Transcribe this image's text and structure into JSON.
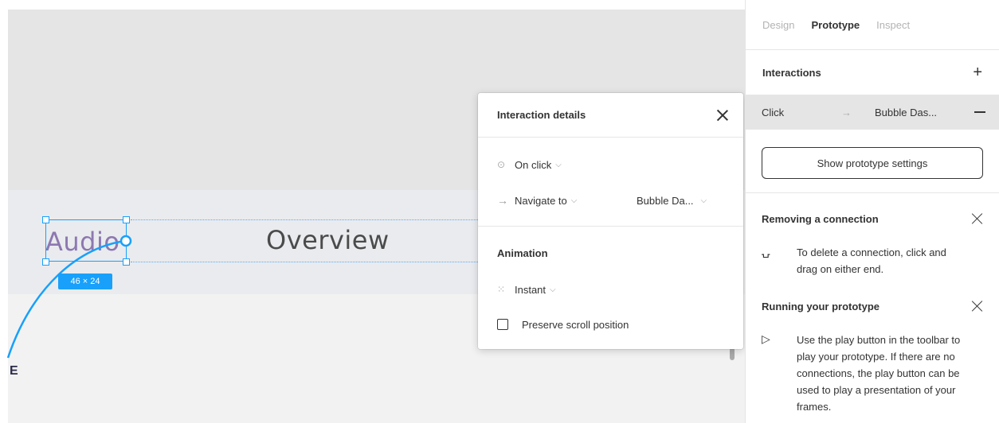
{
  "canvas": {
    "audio_label": "Audio",
    "overview_label": "Overview",
    "size_badge": "46 × 24",
    "frame_letter": "E"
  },
  "popup": {
    "title": "Interaction details",
    "trigger_label": "On click",
    "action_label": "Navigate to",
    "destination_label": "Bubble Da...",
    "animation_title": "Animation",
    "animation_value": "Instant",
    "preserve_label": "Preserve scroll position",
    "preserve_checked": false
  },
  "panel": {
    "tabs": [
      {
        "label": "Design",
        "active": false
      },
      {
        "label": "Prototype",
        "active": true
      },
      {
        "label": "Inspect",
        "active": false
      }
    ],
    "interactions_title": "Interactions",
    "interaction": {
      "trigger": "Click",
      "destination": "Bubble Das..."
    },
    "settings_button": "Show prototype settings",
    "tips": [
      {
        "title": "Removing a connection",
        "text": "To delete a connection, click and drag on either end."
      },
      {
        "title": "Running your prototype",
        "text": "Use the play button in the toolbar to play your prototype. If there are no connections, the play button can be used to play a presentation of your frames."
      }
    ]
  },
  "colors": {
    "selection": "#18a0fb",
    "audio_text": "#8d78b0"
  }
}
